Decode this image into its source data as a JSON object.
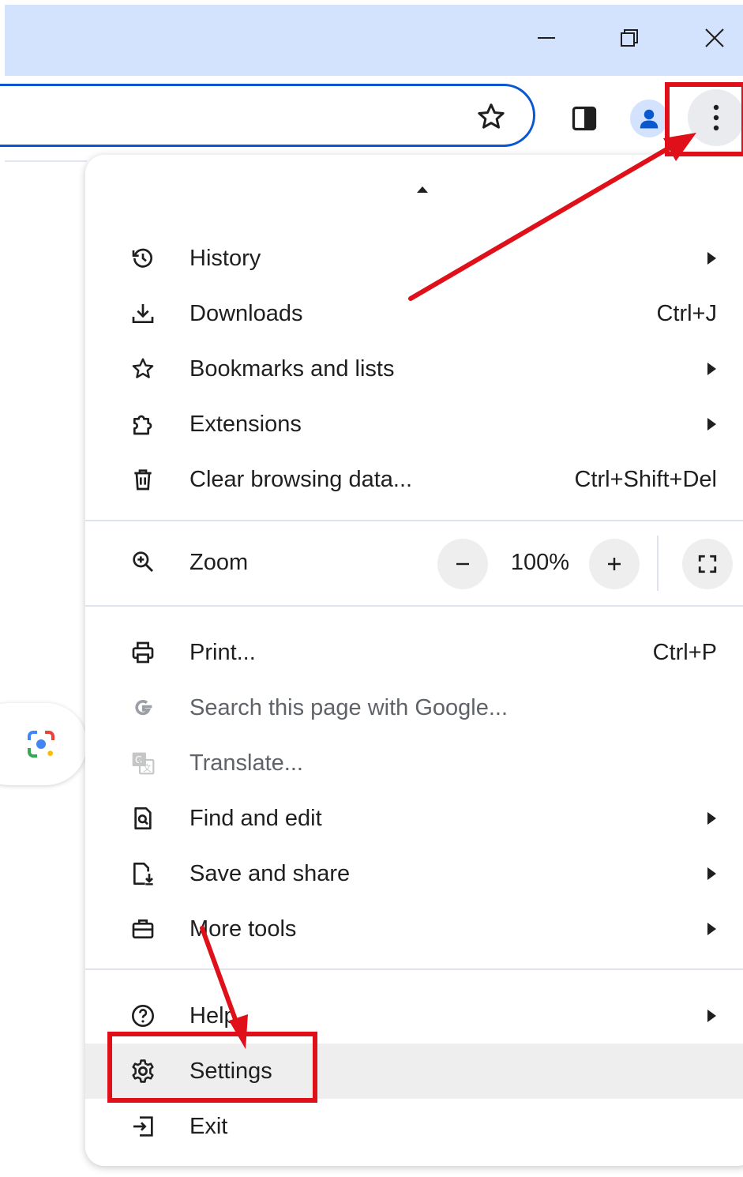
{
  "window": {
    "minimize_icon": "minimize-icon",
    "restore_icon": "restore-icon",
    "close_icon": "close-icon"
  },
  "toolbar": {
    "bookmark_icon": "star-outline-icon",
    "side_panel_icon": "side-panel-icon",
    "profile_icon": "profile-avatar-icon",
    "menu_icon": "vertical-dots-icon"
  },
  "menu": {
    "group1": [
      {
        "label": "History",
        "icon": "history-icon",
        "submenu": true,
        "shortcut": ""
      },
      {
        "label": "Downloads",
        "icon": "download-icon",
        "submenu": false,
        "shortcut": "Ctrl+J"
      },
      {
        "label": "Bookmarks and lists",
        "icon": "star-icon",
        "submenu": true,
        "shortcut": ""
      },
      {
        "label": "Extensions",
        "icon": "puzzle-icon",
        "submenu": true,
        "shortcut": ""
      },
      {
        "label": "Clear browsing data...",
        "icon": "trash-icon",
        "submenu": false,
        "shortcut": "Ctrl+Shift+Del"
      }
    ],
    "zoom": {
      "label": "Zoom",
      "value": "100%",
      "minus": "−",
      "plus": "+",
      "fullscreen_icon": "fullscreen-icon"
    },
    "group2": [
      {
        "label": "Print...",
        "icon": "printer-icon",
        "submenu": false,
        "shortcut": "Ctrl+P",
        "disabled": false
      },
      {
        "label": "Search this page with Google...",
        "icon": "google-g-icon",
        "submenu": false,
        "shortcut": "",
        "disabled": true
      },
      {
        "label": "Translate...",
        "icon": "translate-icon",
        "submenu": false,
        "shortcut": "",
        "disabled": true
      },
      {
        "label": "Find and edit",
        "icon": "find-page-icon",
        "submenu": true,
        "shortcut": "",
        "disabled": false
      },
      {
        "label": "Save and share",
        "icon": "save-share-icon",
        "submenu": true,
        "shortcut": "",
        "disabled": false
      },
      {
        "label": "More tools",
        "icon": "toolbox-icon",
        "submenu": true,
        "shortcut": "",
        "disabled": false
      }
    ],
    "group3": [
      {
        "label": "Help",
        "icon": "help-icon",
        "submenu": true
      },
      {
        "label": "Settings",
        "icon": "gear-icon",
        "submenu": false
      },
      {
        "label": "Exit",
        "icon": "exit-icon",
        "submenu": false
      }
    ]
  },
  "colors": {
    "annotation": "#e0101a",
    "titlebar": "#d3e3fd",
    "accent": "#0b57d0"
  }
}
